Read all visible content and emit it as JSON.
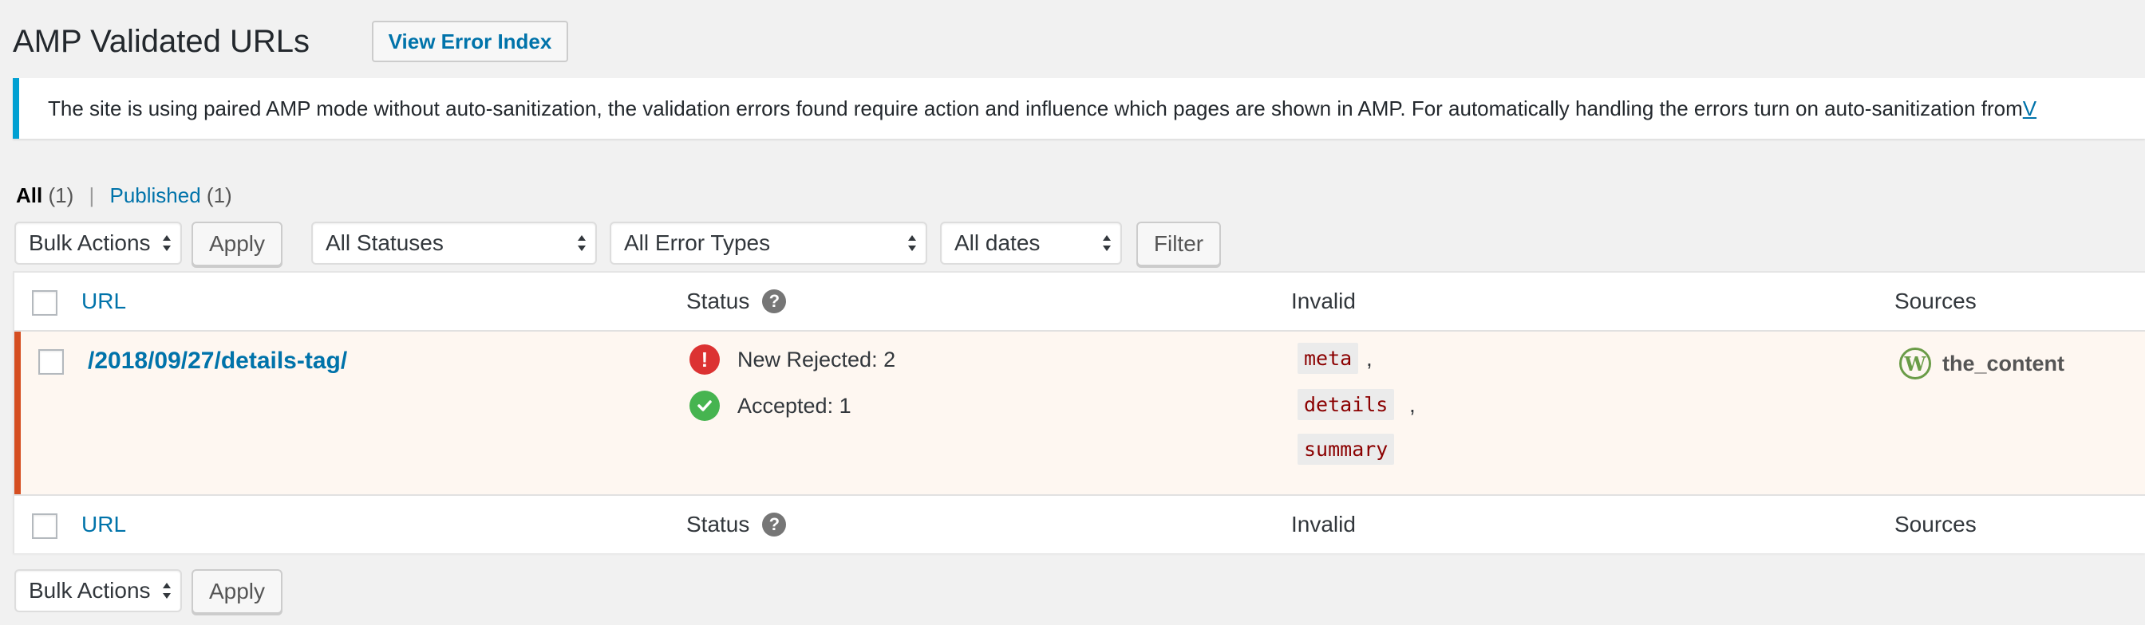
{
  "header": {
    "title": "AMP Validated URLs",
    "view_error_index": "View Error Index"
  },
  "notice": {
    "text": "The site is using paired AMP mode without auto-sanitization, the validation errors found require action and influence which pages are shown in AMP. For automatically handling the errors turn on auto-sanitization from ",
    "link": "V"
  },
  "views": {
    "all_label": "All",
    "all_count": "(1)",
    "separator": "|",
    "published_label": "Published",
    "published_count": "(1)"
  },
  "tablenav_top": {
    "bulk_actions": "Bulk Actions",
    "apply": "Apply",
    "status_filter": "All Statuses",
    "error_type_filter": "All Error Types",
    "date_filter": "All dates",
    "filter_button": "Filter"
  },
  "table": {
    "columns": {
      "url": "URL",
      "status": "Status",
      "help": "?",
      "invalid": "Invalid",
      "sources": "Sources"
    },
    "rows": [
      {
        "url": "/2018/09/27/details-tag/",
        "status_rejected": "New Rejected: 2",
        "status_accepted": "Accepted: 1",
        "invalid": [
          "meta",
          "details",
          "summary"
        ],
        "source": "the_content"
      }
    ]
  },
  "tablenav_bottom": {
    "bulk_actions": "Bulk Actions",
    "apply": "Apply"
  },
  "colors": {
    "accent": "#0073aa",
    "notice_border": "#00a0d2",
    "error_row_border": "#d54e21",
    "rejected": "#dc3232",
    "accepted": "#46b450"
  },
  "icons": {
    "rejected": "error-icon",
    "accepted": "checkmark-icon",
    "help": "help-icon",
    "source": "wordpress-icon"
  }
}
